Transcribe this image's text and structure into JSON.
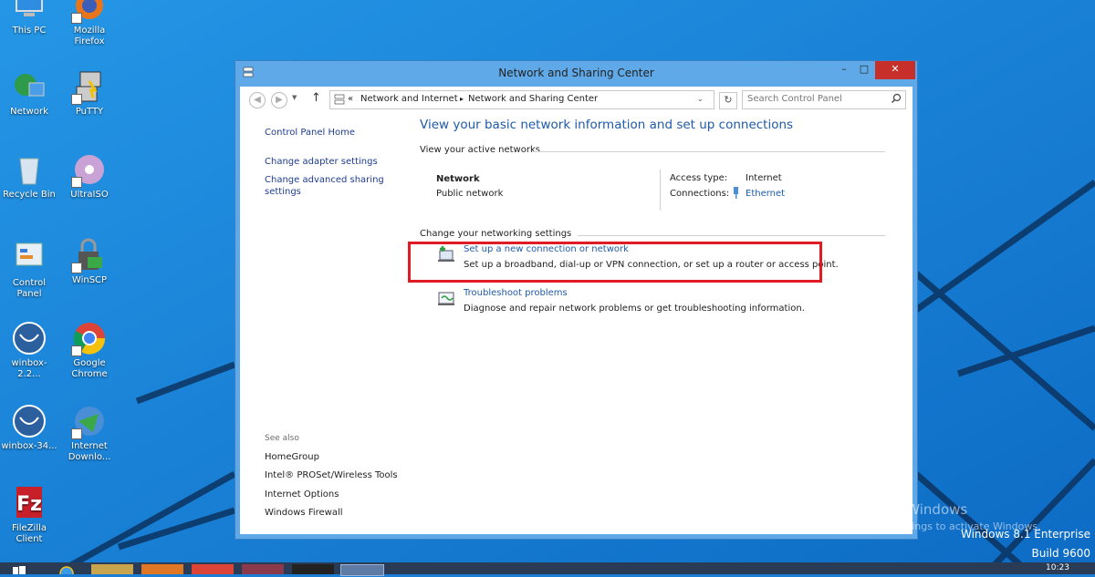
{
  "desktop": {
    "icons": [
      {
        "label": "This PC",
        "icon": "this-pc-icon"
      },
      {
        "label": "Mozilla\nFirefox",
        "icon": "firefox-icon"
      },
      {
        "label": "Network",
        "icon": "network-icon"
      },
      {
        "label": "PuTTY",
        "icon": "putty-icon"
      },
      {
        "label": "Recycle Bin",
        "icon": "recycle-bin-icon"
      },
      {
        "label": "UltraISO",
        "icon": "ultraiso-icon"
      },
      {
        "label": "Control\nPanel",
        "icon": "control-panel-icon"
      },
      {
        "label": "WinSCP",
        "icon": "winscp-icon"
      },
      {
        "label": "winbox-2.2...",
        "icon": "winbox-icon"
      },
      {
        "label": "Google\nChrome",
        "icon": "chrome-icon"
      },
      {
        "label": "winbox-34...",
        "icon": "winbox-icon"
      },
      {
        "label": "Internet\nDownlo...",
        "icon": "internet-download-manager-icon"
      },
      {
        "label": "FileZilla\nClient",
        "icon": "filezilla-icon"
      }
    ]
  },
  "window": {
    "title": "Network and Sharing Center",
    "minimize": "–",
    "maximize": "□",
    "close": "✕",
    "breadcrumb": {
      "prefix": "«",
      "items": [
        "Network and Internet",
        "Network and Sharing Center"
      ],
      "separator": "▸"
    },
    "search": {
      "placeholder": "Search Control Panel"
    }
  },
  "sidebar": {
    "home": "Control Panel Home",
    "links": [
      "Change adapter settings",
      "Change advanced sharing\nsettings"
    ],
    "see_also_title": "See also",
    "see_also": [
      "HomeGroup",
      "Intel® PROSet/Wireless Tools",
      "Internet Options",
      "Windows Firewall"
    ]
  },
  "main": {
    "heading": "View your basic network information and set up connections",
    "active_networks_label": "View your active networks",
    "network": {
      "name": "Network",
      "type": "Public network",
      "access_type_label": "Access type:",
      "access_type_value": "Internet",
      "connections_label": "Connections:",
      "connections_value": "Ethernet"
    },
    "change_settings_label": "Change your networking settings",
    "tasks": [
      {
        "title": "Set up a new connection or network",
        "desc": "Set up a broadband, dial-up or VPN connection, or set up a router or access point."
      },
      {
        "title": "Troubleshoot problems",
        "desc": "Diagnose and repair network problems or get troubleshooting information."
      }
    ]
  },
  "watermark": {
    "line1": "Activate Windows",
    "line2": "Go to PC settings to activate Windows."
  },
  "os_info": {
    "edition": "Windows 8.1 Enterprise",
    "build": "Build 9600"
  },
  "taskbar": {
    "clock": "10:23"
  },
  "colors": {
    "desktop_bg": "#1b7ed6",
    "window_frame": "#5fa9e8",
    "link_blue": "#1f5aa8",
    "highlight_red": "#e01b24",
    "close_red": "#c7302a"
  }
}
